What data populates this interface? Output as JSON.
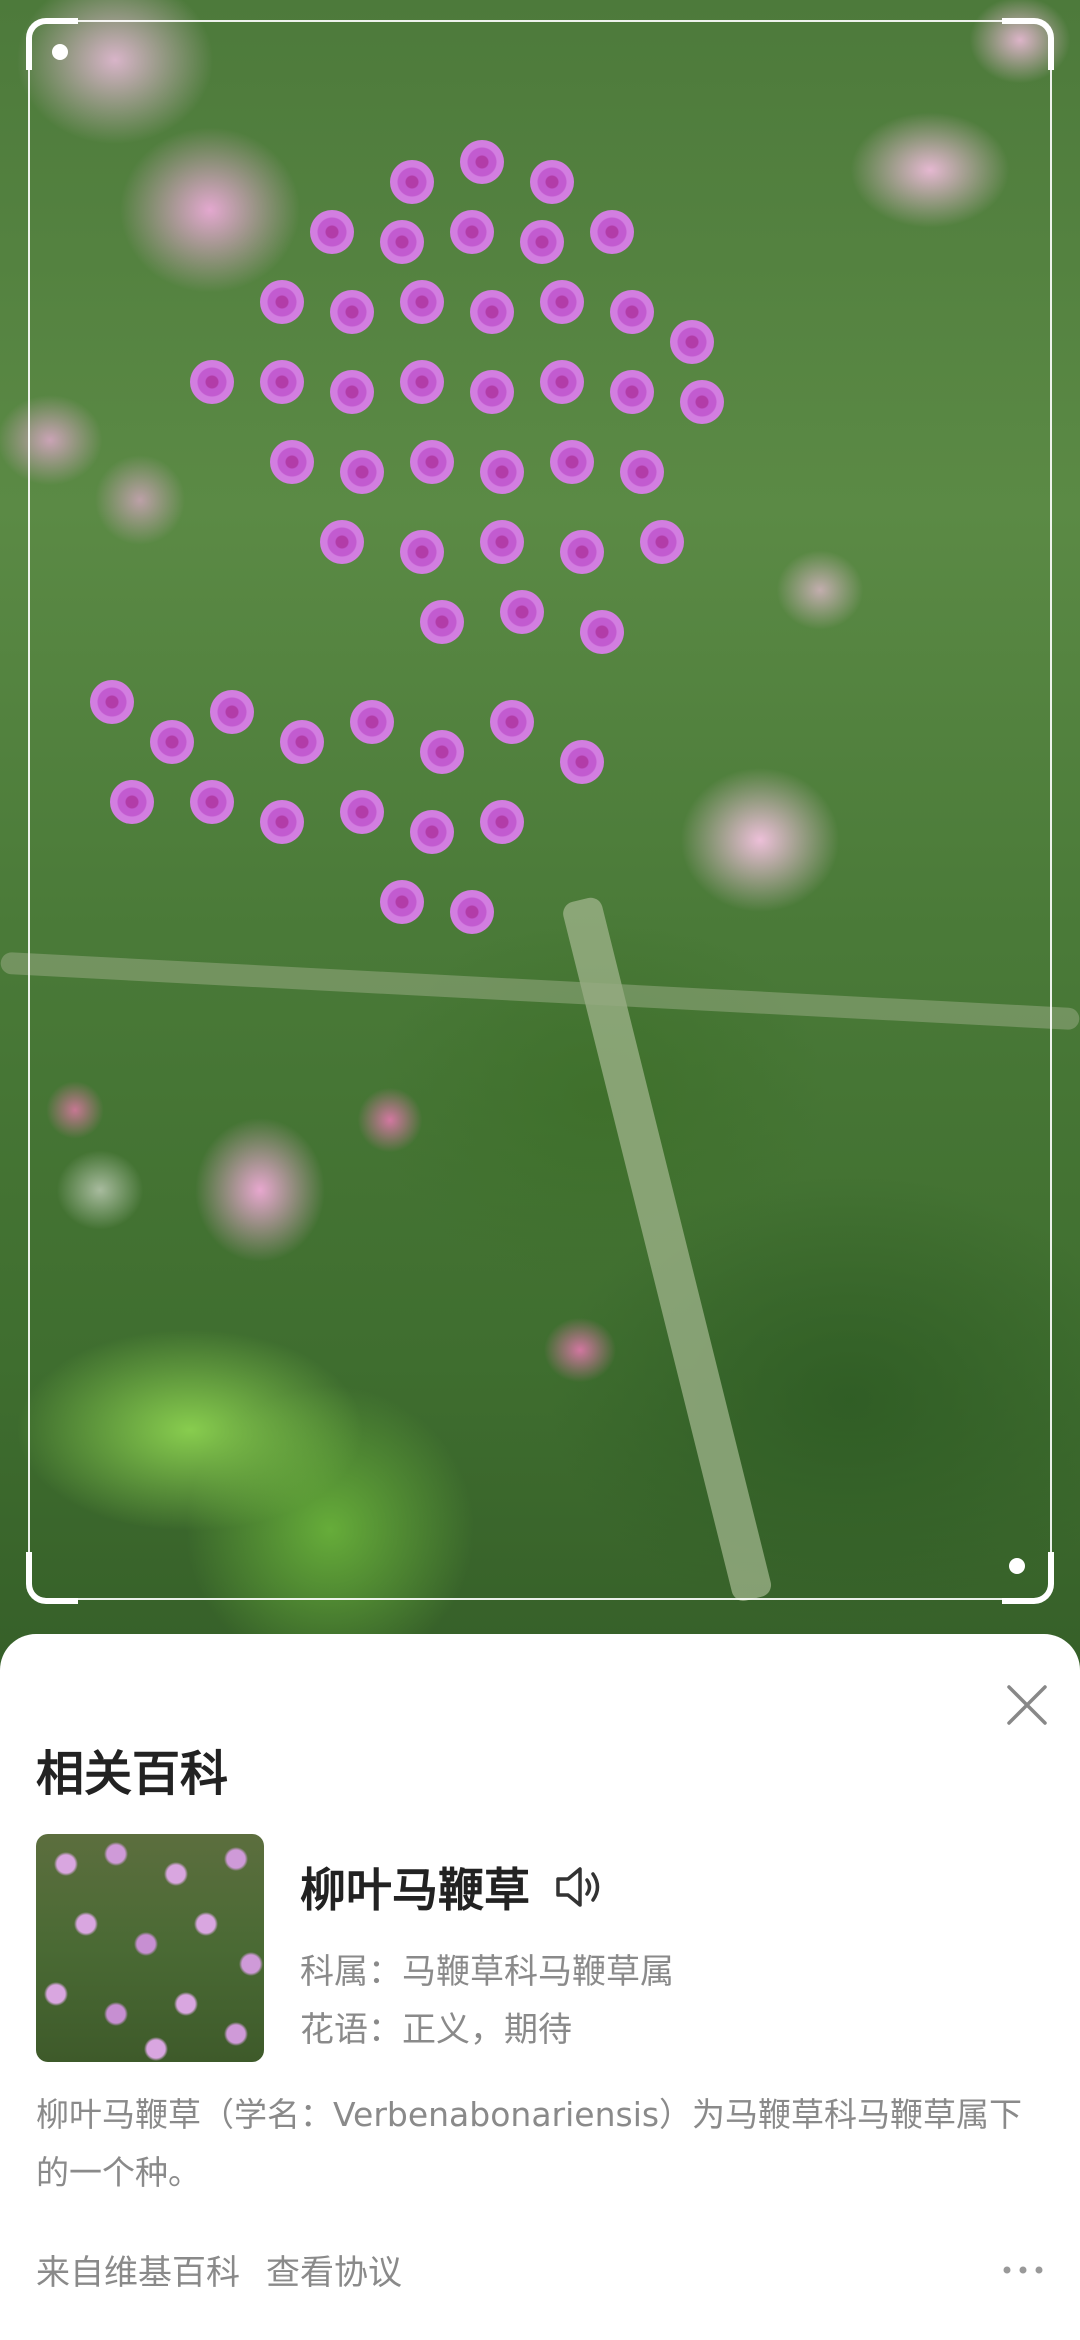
{
  "card": {
    "title": "相关百科",
    "close_icon": "close-icon",
    "flower": {
      "name": "柳叶马鞭草",
      "speaker_icon": "speaker-icon",
      "family_line": "科属：马鞭草科马鞭草属",
      "language_line": "花语：正义，期待"
    },
    "description": "柳叶马鞭草（学名：Verbenabonariensis）为马鞭草科马鞭草属下的一个种。",
    "footer": {
      "source_link": "来自维基百科",
      "agreement_link": "查看协议",
      "more_icon": "more-icon"
    }
  },
  "colors": {
    "card_background": "#ffffff",
    "title_text": "#222222",
    "secondary_text": "#8a8a8a",
    "scan_frame": "#ffffff",
    "flower_purple": "#c25bd0"
  }
}
